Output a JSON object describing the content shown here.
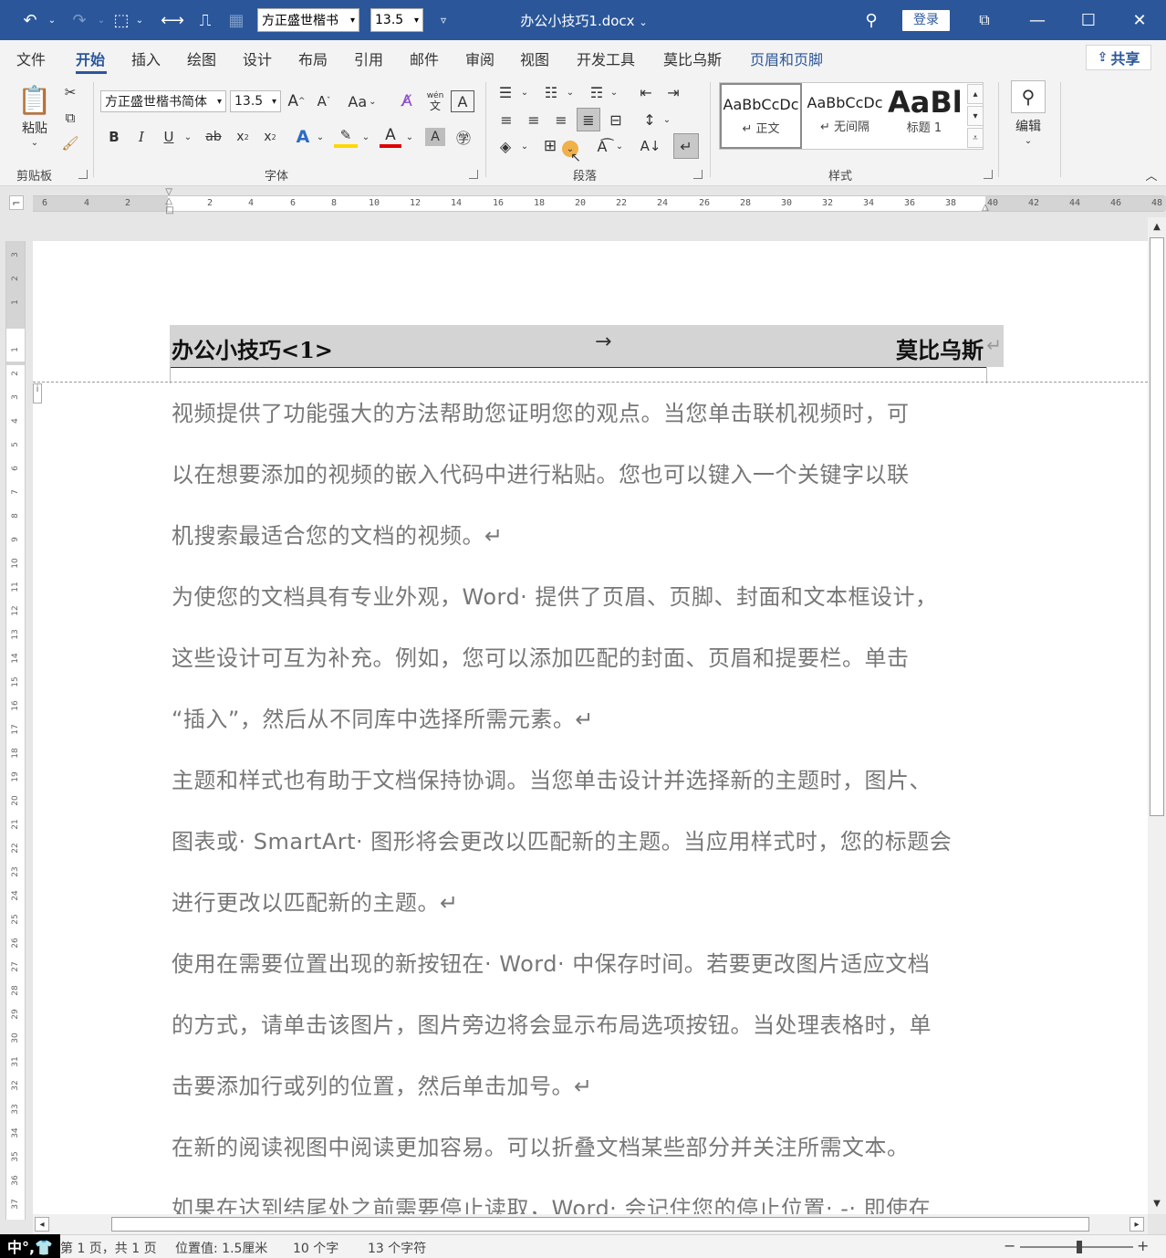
{
  "titlebar": {
    "font_name": "方正盛世楷书",
    "font_size": "13.5",
    "doc_title": "办公小技巧1.docx",
    "login": "登录"
  },
  "menu": {
    "tabs": [
      "文件",
      "开始",
      "插入",
      "绘图",
      "设计",
      "布局",
      "引用",
      "邮件",
      "审阅",
      "视图",
      "开发工具",
      "莫比乌斯",
      "页眉和页脚"
    ],
    "share": "共享"
  },
  "ribbon": {
    "clipboard": {
      "paste": "粘贴",
      "label": "剪贴板"
    },
    "font": {
      "name": "方正盛世楷书简体",
      "size": "13.5",
      "label": "字体",
      "change_case": "Aa",
      "pinyin": "wén"
    },
    "paragraph": {
      "label": "段落"
    },
    "styles": {
      "label": "样式",
      "items": [
        {
          "sample": "AaBbCcDc",
          "name": "↵ 正文"
        },
        {
          "sample": "AaBbCcDc",
          "name": "↵ 无间隔"
        },
        {
          "sample": "AaBl",
          "name": "标题 1"
        }
      ]
    },
    "editing": {
      "label": "编辑"
    }
  },
  "ruler": {
    "ticks": [
      "6",
      "4",
      "2",
      "2",
      "4",
      "6",
      "8",
      "10",
      "12",
      "14",
      "16",
      "18",
      "20",
      "22",
      "24",
      "26",
      "28",
      "30",
      "32",
      "34",
      "36",
      "38",
      "40",
      "42",
      "44",
      "46",
      "48"
    ]
  },
  "vruler": {
    "ticks": [
      "3",
      "2",
      "1",
      "1",
      "2",
      "3",
      "4",
      "5",
      "6",
      "7",
      "8",
      "9",
      "10",
      "11",
      "12",
      "13",
      "14",
      "15",
      "16",
      "17",
      "18",
      "19",
      "20",
      "21",
      "22",
      "23",
      "24",
      "25",
      "26",
      "27",
      "28",
      "29",
      "30",
      "31",
      "32",
      "33",
      "34",
      "35",
      "36",
      "37",
      "38"
    ]
  },
  "document": {
    "header_left": "办公小技巧<1>",
    "header_tab": "→",
    "header_right": "莫比乌斯",
    "header_mark": "↵",
    "lines": [
      "视频提供了功能强大的方法帮助您证明您的观点。当您单击联机视频时，可",
      "以在想要添加的视频的嵌入代码中进行粘贴。您也可以键入一个关键字以联",
      "机搜索最适合您的文档的视频。↵",
      "为使您的文档具有专业外观，Word· 提供了页眉、页脚、封面和文本框设计，",
      "这些设计可互为补充。例如，您可以添加匹配的封面、页眉和提要栏。单击",
      "“插入”，然后从不同库中选择所需元素。↵",
      "主题和样式也有助于文档保持协调。当您单击设计并选择新的主题时，图片、",
      "图表或· SmartArt· 图形将会更改以匹配新的主题。当应用样式时，您的标题会",
      "进行更改以匹配新的主题。↵",
      "使用在需要位置出现的新按钮在· Word· 中保存时间。若要更改图片适应文档",
      "的方式，请单击该图片，图片旁边将会显示布局选项按钮。当处理表格时，单",
      "击要添加行或列的位置，然后单击加号。↵",
      "在新的阅读视图中阅读更加容易。可以折叠文档某些部分并关注所需文本。",
      "如果在达到结尾处之前需要停止读取，Word· 会记住您的停止位置· -· 即使在"
    ]
  },
  "status": {
    "ime": "中°,👕",
    "page": "第 1 页，共 1 页",
    "position": "位置值: 1.5厘米",
    "words": "10 个字",
    "chars": "13 个字符"
  },
  "colors": {
    "accent": "#2b579a",
    "highlight": "#ffd700",
    "font_red": "#e00000"
  }
}
